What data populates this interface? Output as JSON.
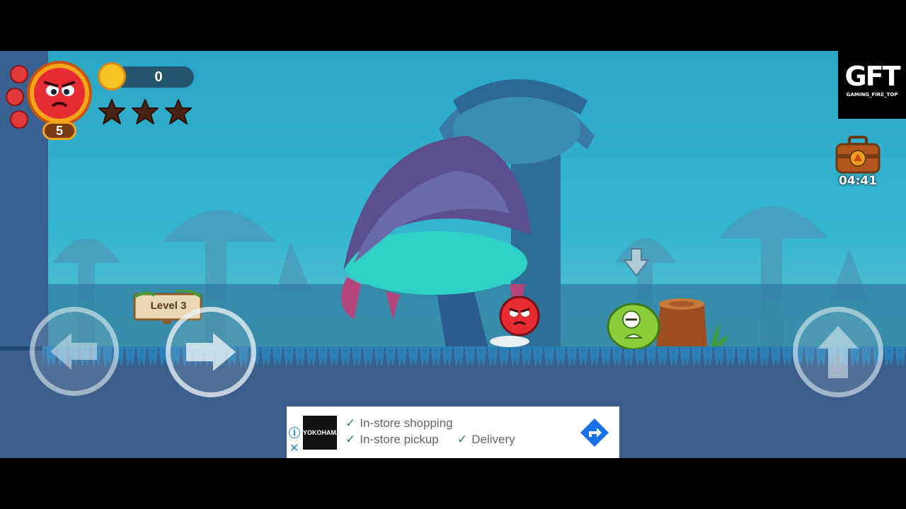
{
  "hud": {
    "lives_count": "5",
    "coin_count": "0",
    "stars_total": 3,
    "stars_earned": 0,
    "timer": "04:41"
  },
  "watermark": {
    "logo": "GFT",
    "caption": "GAMING_FIRE_TOP"
  },
  "level_sign": "Level 3",
  "controls": {
    "left": "left-arrow-icon",
    "right": "right-arrow-icon",
    "jump": "up-arrow-icon"
  },
  "ad": {
    "brand": "YOKOHAMA",
    "line1": "In-store shopping",
    "line2a": "In-store pickup",
    "line2b": "Delivery",
    "info_icon": "i",
    "close_icon": "✕"
  },
  "colors": {
    "player": "#e72b33",
    "enemy": "#8ccd3a",
    "sky": "#35b6cf",
    "ground": "#3b5f8a"
  }
}
